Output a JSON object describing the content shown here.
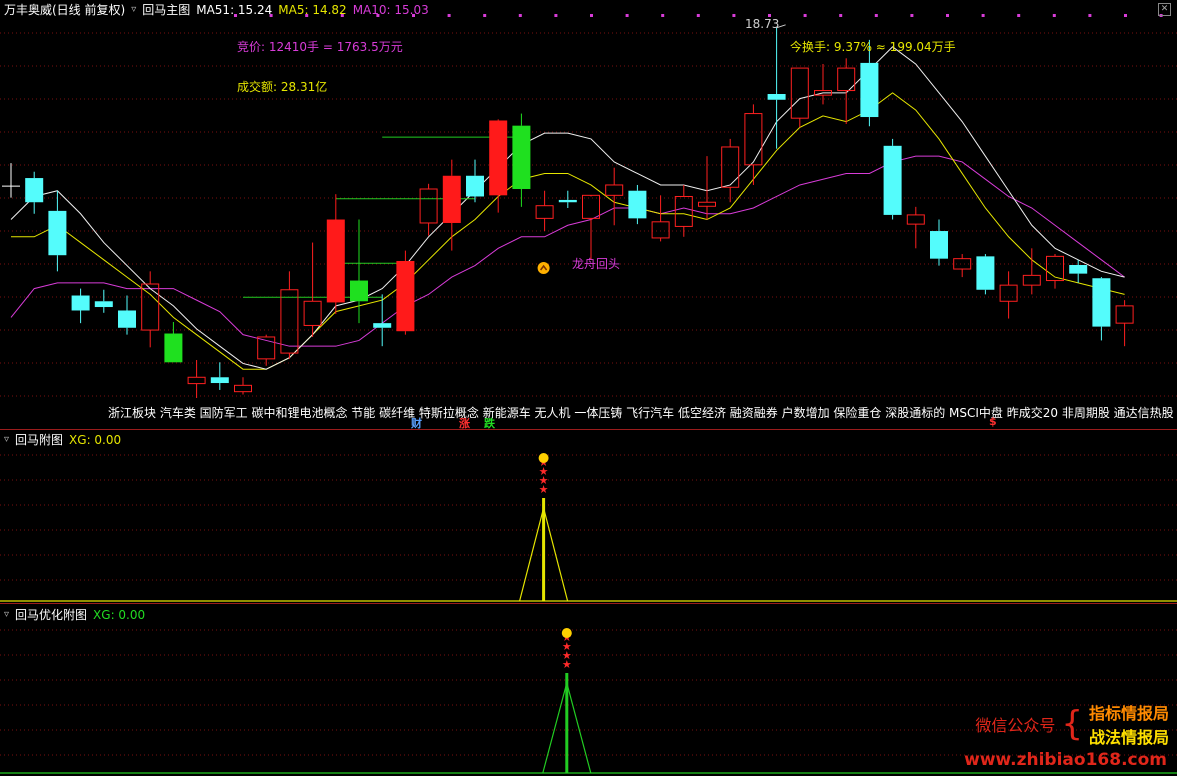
{
  "header": {
    "stock_title": "万丰奥威(日线 前复权)",
    "main_indicator": "回马主图",
    "ma51_label": "MA51: 15.24",
    "ma5_label": "MA5: 14.82",
    "ma10_label": "MA10: 15.03"
  },
  "annotations": {
    "auction_label": "竞价:",
    "auction_value": "12410手 = 1763.5万元",
    "turnover_amount_label": "成交额:",
    "turnover_amount_value": "28.31亿",
    "turnover_rate_label": "今换手:",
    "turnover_rate_value": "9.37% ≈ 199.04万手",
    "high_price": "18.73",
    "signal_label": "龙舟回头"
  },
  "concepts": "浙江板块 汽车类 国防军工 碳中和锂电池概念 节能 碳纤维 特斯拉概念 新能源车 无人机 一体压铸 飞行汽车 低空经济 融资融券 户数增加 保险重仓 深股通标的 MSCI中盘 昨成交20 非周期股 通达信热股",
  "tags": {
    "cai": "财",
    "zhang": "涨",
    "die": "跌",
    "dollar": "$"
  },
  "sub1": {
    "title": "回马附图",
    "value_label": "XG: 0.00"
  },
  "sub2": {
    "title": "回马优化附图",
    "value_label": "XG: 0.00"
  },
  "watermark": {
    "left": "微信公众号",
    "right1": "指标情报局",
    "right2": "战法情报局",
    "url": "www.zhibiao168.com"
  },
  "colors": {
    "up": "#ff2020",
    "down": "#54fcfc",
    "ma_white": "#f0f0f0",
    "ma_yellow": "#e6e600",
    "ma_magenta": "#d83cd8",
    "hline": "#22cc22"
  },
  "chart_data": {
    "type": "candlestick",
    "price_range": [
      12.3,
      18.9
    ],
    "candles": [
      {
        "o": 15.98,
        "h": 16.38,
        "l": 15.78,
        "c": 15.98,
        "k": "doji"
      },
      {
        "o": 16.12,
        "h": 16.23,
        "l": 15.5,
        "c": 15.7,
        "k": "down"
      },
      {
        "o": 15.55,
        "h": 15.9,
        "l": 14.5,
        "c": 14.78,
        "k": "down"
      },
      {
        "o": 14.08,
        "h": 14.2,
        "l": 13.6,
        "c": 13.82,
        "k": "down"
      },
      {
        "o": 13.98,
        "h": 14.18,
        "l": 13.78,
        "c": 13.88,
        "k": "down"
      },
      {
        "o": 13.82,
        "h": 14.08,
        "l": 13.4,
        "c": 13.52,
        "k": "down"
      },
      {
        "o": 13.48,
        "h": 14.5,
        "l": 13.18,
        "c": 14.28,
        "k": "up"
      },
      {
        "o": 13.42,
        "h": 13.62,
        "l": 12.92,
        "c": 12.92,
        "k": "green"
      },
      {
        "o": 12.55,
        "h": 12.96,
        "l": 12.3,
        "c": 12.66,
        "k": "up"
      },
      {
        "o": 12.66,
        "h": 12.92,
        "l": 12.44,
        "c": 12.56,
        "k": "down"
      },
      {
        "o": 12.41,
        "h": 12.66,
        "l": 12.36,
        "c": 12.52,
        "k": "up"
      },
      {
        "o": 12.98,
        "h": 13.4,
        "l": 12.86,
        "c": 13.36,
        "k": "up"
      },
      {
        "o": 13.08,
        "h": 14.5,
        "l": 12.98,
        "c": 14.18,
        "k": "up"
      },
      {
        "o": 13.56,
        "h": 15.0,
        "l": 13.36,
        "c": 13.98,
        "k": "up"
      },
      {
        "o": 13.96,
        "h": 15.84,
        "l": 13.76,
        "c": 15.4,
        "k": "red"
      },
      {
        "o": 14.34,
        "h": 15.4,
        "l": 13.6,
        "c": 13.98,
        "k": "green"
      },
      {
        "o": 13.6,
        "h": 14.1,
        "l": 13.2,
        "c": 13.52,
        "k": "down"
      },
      {
        "o": 13.46,
        "h": 14.86,
        "l": 13.4,
        "c": 14.68,
        "k": "red"
      },
      {
        "o": 15.34,
        "h": 16.02,
        "l": 15.12,
        "c": 15.93,
        "k": "up"
      },
      {
        "o": 15.34,
        "h": 16.44,
        "l": 14.86,
        "c": 16.16,
        "k": "red"
      },
      {
        "o": 16.16,
        "h": 16.44,
        "l": 15.7,
        "c": 15.8,
        "k": "down"
      },
      {
        "o": 15.82,
        "h": 17.14,
        "l": 15.52,
        "c": 17.12,
        "k": "red"
      },
      {
        "o": 17.03,
        "h": 17.24,
        "l": 15.62,
        "c": 15.93,
        "k": "green"
      },
      {
        "o": 15.42,
        "h": 15.9,
        "l": 15.2,
        "c": 15.64,
        "k": "up"
      },
      {
        "o": 15.74,
        "h": 15.9,
        "l": 15.6,
        "c": 15.7,
        "k": "down"
      },
      {
        "o": 15.42,
        "h": 15.8,
        "l": 14.7,
        "c": 15.82,
        "k": "up"
      },
      {
        "o": 15.82,
        "h": 16.3,
        "l": 15.3,
        "c": 16.0,
        "k": "up"
      },
      {
        "o": 15.9,
        "h": 16.0,
        "l": 15.32,
        "c": 15.42,
        "k": "down"
      },
      {
        "o": 15.08,
        "h": 15.82,
        "l": 15.02,
        "c": 15.36,
        "k": "up"
      },
      {
        "o": 15.28,
        "h": 16.0,
        "l": 15.1,
        "c": 15.8,
        "k": "up"
      },
      {
        "o": 15.63,
        "h": 16.5,
        "l": 15.4,
        "c": 15.7,
        "k": "up"
      },
      {
        "o": 15.96,
        "h": 16.8,
        "l": 15.7,
        "c": 16.66,
        "k": "up"
      },
      {
        "o": 16.35,
        "h": 17.4,
        "l": 16.0,
        "c": 17.24,
        "k": "up"
      },
      {
        "o": 17.48,
        "h": 18.73,
        "l": 16.63,
        "c": 17.58,
        "k": "down"
      },
      {
        "o": 17.16,
        "h": 18.03,
        "l": 17.0,
        "c": 18.03,
        "k": "up"
      },
      {
        "o": 17.56,
        "h": 18.1,
        "l": 17.4,
        "c": 17.64,
        "k": "up"
      },
      {
        "o": 17.64,
        "h": 18.2,
        "l": 17.06,
        "c": 18.03,
        "k": "up"
      },
      {
        "o": 18.12,
        "h": 18.52,
        "l": 17.02,
        "c": 17.18,
        "k": "down"
      },
      {
        "o": 16.68,
        "h": 16.8,
        "l": 15.4,
        "c": 15.48,
        "k": "down"
      },
      {
        "o": 15.48,
        "h": 15.62,
        "l": 14.9,
        "c": 15.32,
        "k": "up"
      },
      {
        "o": 15.2,
        "h": 15.4,
        "l": 14.6,
        "c": 14.72,
        "k": "down"
      },
      {
        "o": 14.54,
        "h": 14.8,
        "l": 14.4,
        "c": 14.72,
        "k": "up"
      },
      {
        "o": 14.76,
        "h": 14.8,
        "l": 14.1,
        "c": 14.18,
        "k": "down"
      },
      {
        "o": 13.98,
        "h": 14.5,
        "l": 13.68,
        "c": 14.26,
        "k": "up"
      },
      {
        "o": 14.26,
        "h": 14.9,
        "l": 14.1,
        "c": 14.43,
        "k": "up"
      },
      {
        "o": 14.34,
        "h": 14.8,
        "l": 14.2,
        "c": 14.76,
        "k": "up"
      },
      {
        "o": 14.61,
        "h": 14.7,
        "l": 14.3,
        "c": 14.46,
        "k": "down"
      },
      {
        "o": 14.38,
        "h": 14.4,
        "l": 13.3,
        "c": 13.54,
        "k": "down"
      },
      {
        "o": 13.6,
        "h": 14.0,
        "l": 13.2,
        "c": 13.9,
        "k": "up"
      }
    ],
    "ma_white": [
      15.4,
      15.8,
      15.9,
      15.5,
      15.0,
      14.6,
      14.2,
      13.9,
      13.5,
      13.2,
      12.9,
      12.8,
      13.0,
      13.4,
      13.9,
      14.0,
      14.2,
      14.6,
      15.1,
      15.5,
      15.9,
      16.3,
      16.7,
      16.9,
      16.9,
      16.8,
      16.4,
      16.2,
      16.0,
      16.0,
      15.9,
      16.0,
      16.4,
      17.1,
      17.5,
      17.6,
      17.6,
      18.0,
      18.4,
      18.1,
      17.6,
      17.1,
      16.5,
      15.9,
      15.3,
      14.9,
      14.7,
      14.5,
      14.4
    ],
    "ma_yellow": [
      15.1,
      15.1,
      15.3,
      15.0,
      14.7,
      14.4,
      14.1,
      13.7,
      13.4,
      13.1,
      12.8,
      12.8,
      13.0,
      13.4,
      13.8,
      13.9,
      14.0,
      14.3,
      14.7,
      15.1,
      15.4,
      15.8,
      16.1,
      16.2,
      16.2,
      16.0,
      15.7,
      15.6,
      15.5,
      15.5,
      15.4,
      15.6,
      16.1,
      16.6,
      17.0,
      17.2,
      17.1,
      17.3,
      17.6,
      17.3,
      16.8,
      16.2,
      15.6,
      15.1,
      14.7,
      14.4,
      14.3,
      14.2,
      14.1
    ],
    "ma_magenta": [
      13.7,
      14.2,
      14.3,
      14.3,
      14.3,
      14.2,
      14.2,
      14.2,
      14.0,
      13.8,
      13.4,
      13.3,
      13.2,
      13.2,
      13.2,
      13.3,
      13.6,
      13.9,
      14.1,
      14.4,
      14.6,
      14.9,
      15.1,
      15.1,
      15.3,
      15.4,
      15.6,
      15.6,
      15.5,
      15.6,
      15.5,
      15.5,
      15.6,
      15.8,
      16.0,
      16.1,
      16.2,
      16.2,
      16.4,
      16.5,
      16.5,
      16.4,
      16.1,
      15.8,
      15.6,
      15.3,
      15.0,
      14.7,
      14.4
    ],
    "hlines": [
      {
        "y": 14.05,
        "i0": 10,
        "i1": 16
      },
      {
        "y": 14.64,
        "i0": 14,
        "i1": 17
      },
      {
        "y": 15.76,
        "i0": 14,
        "i1": 20
      },
      {
        "y": 16.83,
        "i0": 16,
        "i1": 22
      }
    ],
    "signal_index": 23,
    "sub1_spike_index": 23,
    "sub2_spike_index": 24
  }
}
